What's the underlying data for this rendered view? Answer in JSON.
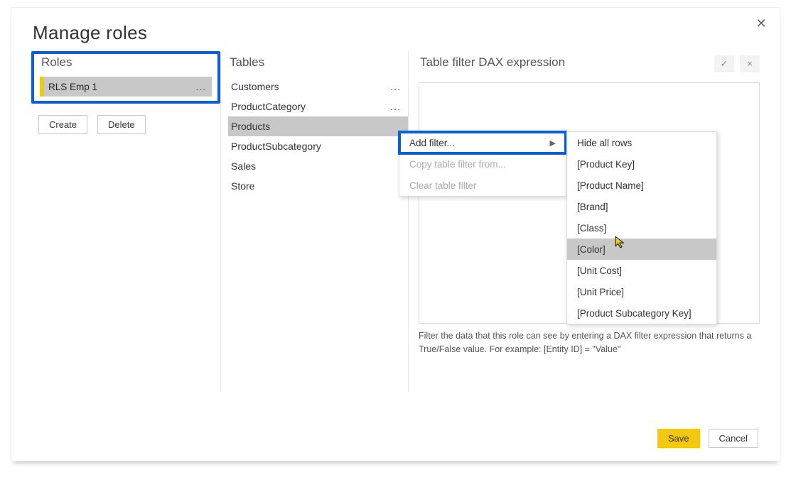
{
  "dialog": {
    "title": "Manage roles"
  },
  "roles": {
    "header": "Roles",
    "items": [
      {
        "name": "RLS Emp 1"
      }
    ],
    "create_label": "Create",
    "delete_label": "Delete"
  },
  "tables": {
    "header": "Tables",
    "items": [
      {
        "name": "Customers",
        "selected": false,
        "show_ellipsis": true
      },
      {
        "name": "ProductCategory",
        "selected": false,
        "show_ellipsis": true
      },
      {
        "name": "Products",
        "selected": true,
        "show_ellipsis": false
      },
      {
        "name": "ProductSubcategory",
        "selected": false,
        "show_ellipsis": false
      },
      {
        "name": "Sales",
        "selected": false,
        "show_ellipsis": false
      },
      {
        "name": "Store",
        "selected": false,
        "show_ellipsis": false
      }
    ]
  },
  "dax": {
    "header": "Table filter DAX expression",
    "hint": "Filter the data that this role can see by entering a DAX filter expression that returns a True/False value. For example: [Entity ID] = \"Value\""
  },
  "context_menu_1": {
    "items": [
      {
        "label": "Add filter...",
        "enabled": true,
        "submenu": true,
        "highlighted": true
      },
      {
        "label": "Copy table filter from...",
        "enabled": false,
        "submenu": false,
        "highlighted": false
      },
      {
        "label": "Clear table filter",
        "enabled": false,
        "submenu": false,
        "highlighted": false
      }
    ]
  },
  "context_menu_2": {
    "items": [
      {
        "label": "Hide all rows",
        "hover": false
      },
      {
        "label": "[Product Key]",
        "hover": false
      },
      {
        "label": "[Product Name]",
        "hover": false
      },
      {
        "label": "[Brand]",
        "hover": false
      },
      {
        "label": "[Class]",
        "hover": false
      },
      {
        "label": "[Color]",
        "hover": true
      },
      {
        "label": "[Unit Cost]",
        "hover": false
      },
      {
        "label": "[Unit Price]",
        "hover": false
      },
      {
        "label": "[Product Subcategory Key]",
        "hover": false
      }
    ]
  },
  "footer": {
    "save": "Save",
    "cancel": "Cancel"
  },
  "glyph": {
    "ellipsis": "...",
    "check": "✓",
    "cross": "×",
    "submenu_arrow": "▶",
    "close": "✕"
  }
}
